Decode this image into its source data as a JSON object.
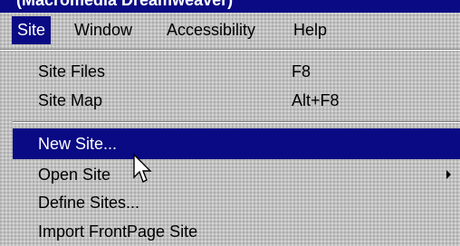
{
  "window": {
    "title": "(Macromedia Dreamweaver)"
  },
  "menubar": {
    "items": [
      {
        "key": "site",
        "label": "Site",
        "active": true
      },
      {
        "key": "window",
        "label": "Window"
      },
      {
        "key": "accessibility",
        "label": "Accessibility"
      },
      {
        "key": "help",
        "label": "Help"
      }
    ]
  },
  "site_menu": {
    "items": [
      {
        "label": "Site Files",
        "shortcut": "F8"
      },
      {
        "label": "Site Map",
        "shortcut": "Alt+F8"
      },
      {
        "label": "New Site...",
        "highlighted": true
      },
      {
        "label": "Open Site",
        "submenu": true
      },
      {
        "label": "Define Sites..."
      },
      {
        "label": "Import FrontPage Site"
      }
    ]
  },
  "colors": {
    "highlight": "#0a0a84",
    "menu_bg": "#c0c0c0"
  },
  "icons": {
    "cursor": "arrow-pointer-icon",
    "submenu": "triangle-right-icon"
  }
}
